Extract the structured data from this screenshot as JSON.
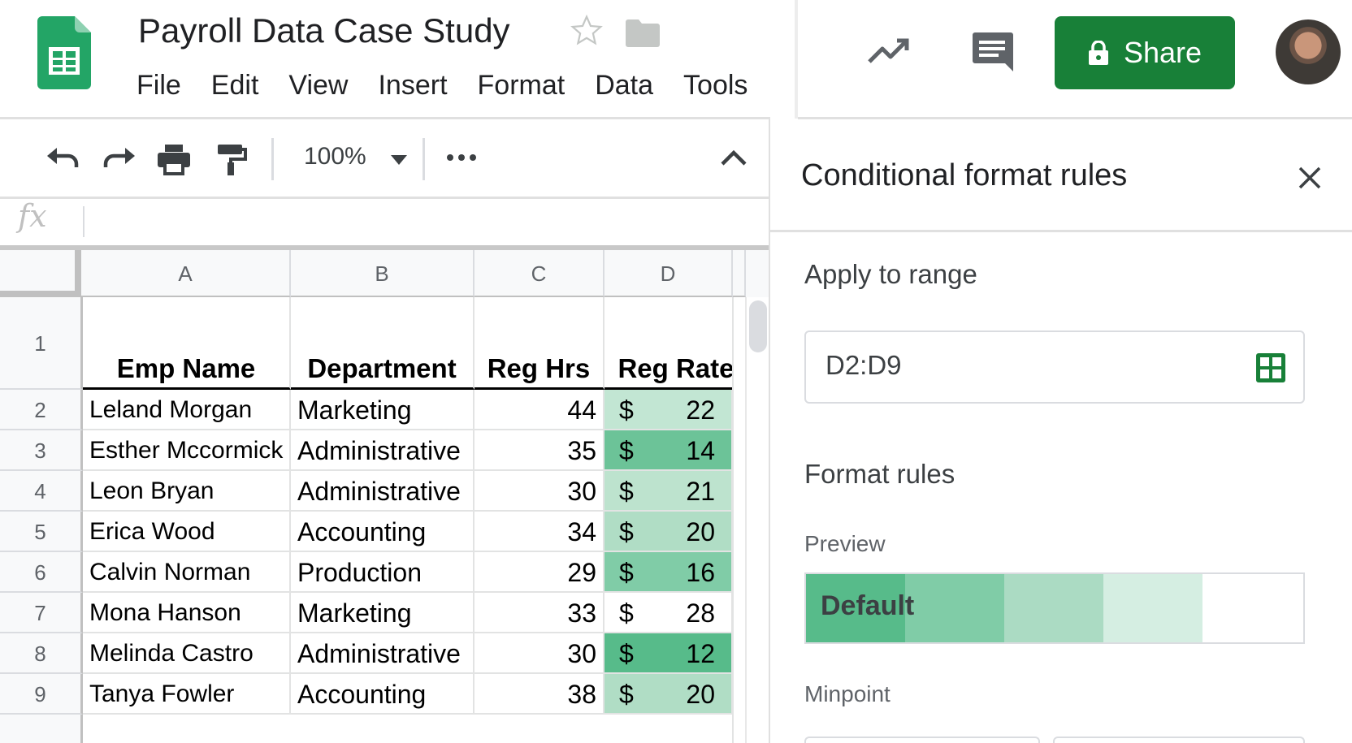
{
  "document": {
    "title": "Payroll Data Case Study"
  },
  "menu": [
    "File",
    "Edit",
    "View",
    "Insert",
    "Format",
    "Data",
    "Tools"
  ],
  "header": {
    "share_label": "Share"
  },
  "toolbar": {
    "zoom": "100%"
  },
  "formula_bar": {
    "fx_label": "fx",
    "value": ""
  },
  "grid": {
    "columns": [
      "A",
      "B",
      "C",
      "D"
    ],
    "row_numbers": [
      "1",
      "2",
      "3",
      "4",
      "5",
      "6",
      "7",
      "8",
      "9"
    ],
    "header_row": [
      "Emp Name",
      "Department",
      "Reg Hrs",
      "Reg Rate"
    ],
    "currency_symbol": "$",
    "rows": [
      {
        "name": "Leland Morgan",
        "dept": "Marketing",
        "hrs": "44",
        "rate": "22",
        "shade": "#c2e6d3"
      },
      {
        "name": "Esther Mccormick",
        "dept": "Administrative",
        "hrs": "35",
        "rate": "14",
        "shade": "#6cc398"
      },
      {
        "name": "Leon Bryan",
        "dept": "Administrative",
        "hrs": "30",
        "rate": "21",
        "shade": "#bde3ce"
      },
      {
        "name": "Erica Wood",
        "dept": "Accounting",
        "hrs": "34",
        "rate": "20",
        "shade": "#b0ddc5"
      },
      {
        "name": "Calvin Norman",
        "dept": "Production",
        "hrs": "29",
        "rate": "16",
        "shade": "#80cca7"
      },
      {
        "name": "Mona Hanson",
        "dept": "Marketing",
        "hrs": "33",
        "rate": "28",
        "shade": "#ffffff"
      },
      {
        "name": "Melinda Castro",
        "dept": "Administrative",
        "hrs": "30",
        "rate": "12",
        "shade": "#57bb8a"
      },
      {
        "name": "Tanya Fowler",
        "dept": "Accounting",
        "hrs": "38",
        "rate": "20",
        "shade": "#b0ddc5"
      }
    ]
  },
  "panel": {
    "title": "Conditional format rules",
    "apply_label": "Apply to range",
    "range_value": "D2:D9",
    "format_rules_label": "Format rules",
    "preview_label": "Preview",
    "preview_text": "Default",
    "preview_colors": [
      "#57bb8a",
      "#80cca7",
      "#abdbc3",
      "#d5eee2",
      "#ffffff"
    ],
    "minpoint_label": "Minpoint"
  },
  "colors": {
    "brand_green": "#188038",
    "sheets_green": "#0f9d58"
  }
}
